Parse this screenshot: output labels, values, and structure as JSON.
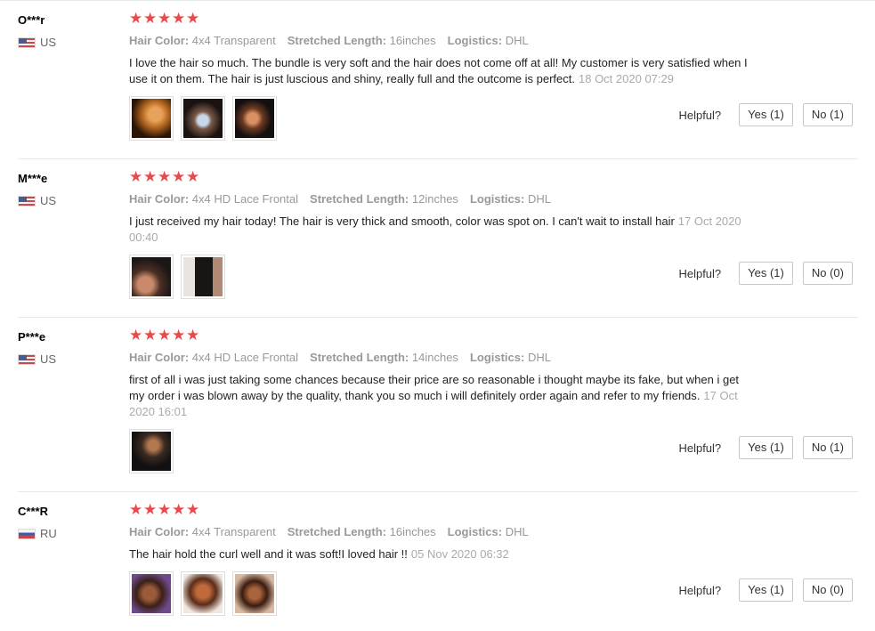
{
  "reviews": [
    {
      "user": "O***r",
      "country": "US",
      "flag": "us",
      "stars": 5,
      "attributes": [
        {
          "label": "Hair Color:",
          "value": "4x4 Transparent"
        },
        {
          "label": "Stretched Length:",
          "value": "16inches"
        },
        {
          "label": "Logistics:",
          "value": "DHL"
        }
      ],
      "text": "I love the hair so much. The bundle is very soft and the hair does not come off at all! My customer is very satisfied when I use it on them. The hair is just luscious and shiny, really full and the outcome is perfect.",
      "date": "18 Oct 2020 07:29",
      "photos": 3,
      "helpful_label": "Helpful?",
      "yes": "Yes (1)",
      "no": "No (1)"
    },
    {
      "user": "M***e",
      "country": "US",
      "flag": "us",
      "stars": 5,
      "attributes": [
        {
          "label": "Hair Color:",
          "value": "4x4 HD Lace Frontal"
        },
        {
          "label": "Stretched Length:",
          "value": "12inches"
        },
        {
          "label": "Logistics:",
          "value": "DHL"
        }
      ],
      "text": "I just received my hair today! The hair is very thick and smooth, color was spot on. I can't wait to install hair",
      "date": "17 Oct 2020 00:40",
      "photos": 2,
      "helpful_label": "Helpful?",
      "yes": "Yes (1)",
      "no": "No (0)"
    },
    {
      "user": "P***e",
      "country": "US",
      "flag": "us",
      "stars": 5,
      "attributes": [
        {
          "label": "Hair Color:",
          "value": "4x4 HD Lace Frontal"
        },
        {
          "label": "Stretched Length:",
          "value": "14inches"
        },
        {
          "label": "Logistics:",
          "value": "DHL"
        }
      ],
      "text": "first of all i was just taking some chances because their price are so reasonable i thought maybe its fake, but when i get my order i was blown away by the quality, thank you so much i will definitely order again and refer to my friends.",
      "date": "17 Oct 2020 16:01",
      "photos": 1,
      "helpful_label": "Helpful?",
      "yes": "Yes (1)",
      "no": "No (1)"
    },
    {
      "user": "C***R",
      "country": "RU",
      "flag": "ru",
      "stars": 5,
      "attributes": [
        {
          "label": "Hair Color:",
          "value": "4x4 Transparent"
        },
        {
          "label": "Stretched Length:",
          "value": "16inches"
        },
        {
          "label": "Logistics:",
          "value": "DHL"
        }
      ],
      "text": "The hair hold the curl well and  it was soft!I loved hair !!",
      "date": "05 Nov 2020 06:32",
      "photos": 3,
      "helpful_label": "Helpful?",
      "yes": "Yes (1)",
      "no": "No (0)"
    }
  ]
}
